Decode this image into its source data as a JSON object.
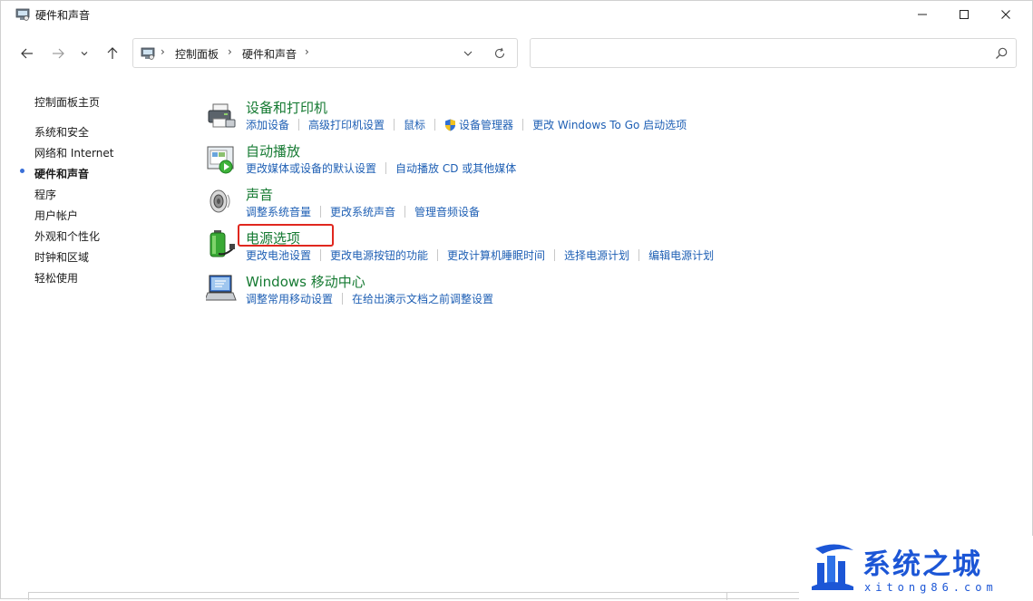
{
  "window": {
    "title": "硬件和声音"
  },
  "address": {
    "crumbs": [
      "控制面板",
      "硬件和声音"
    ]
  },
  "search": {
    "placeholder": ""
  },
  "sidebar": {
    "home": "控制面板主页",
    "items": [
      "系统和安全",
      "网络和 Internet",
      "硬件和声音",
      "程序",
      "用户帐户",
      "外观和个性化",
      "时钟和区域",
      "轻松使用"
    ],
    "current_index": 2
  },
  "categories": [
    {
      "title": "设备和打印机",
      "icon": "printer-icon",
      "links": [
        "添加设备",
        "高级打印机设置",
        "鼠标",
        "设备管理器",
        "更改 Windows To Go 启动选项"
      ]
    },
    {
      "title": "自动播放",
      "icon": "autoplay-icon",
      "links": [
        "更改媒体或设备的默认设置",
        "自动播放 CD 或其他媒体"
      ]
    },
    {
      "title": "声音",
      "icon": "speaker-icon",
      "links": [
        "调整系统音量",
        "更改系统声音",
        "管理音频设备"
      ]
    },
    {
      "title": "电源选项",
      "icon": "battery-icon",
      "links": [
        "更改电池设置",
        "更改电源按钮的功能",
        "更改计算机睡眠时间",
        "选择电源计划",
        "编辑电源计划"
      ]
    },
    {
      "title": "Windows 移动中心",
      "icon": "mobility-center-icon",
      "links": [
        "调整常用移动设置",
        "在给出演示文档之前调整设置"
      ]
    }
  ],
  "watermark": {
    "title": "系统之城",
    "url": "xitong86.com"
  },
  "colors": {
    "category_title": "#157a32",
    "link": "#1e5fb4",
    "highlight": "#e0271e",
    "watermark": "#1c56d6"
  }
}
